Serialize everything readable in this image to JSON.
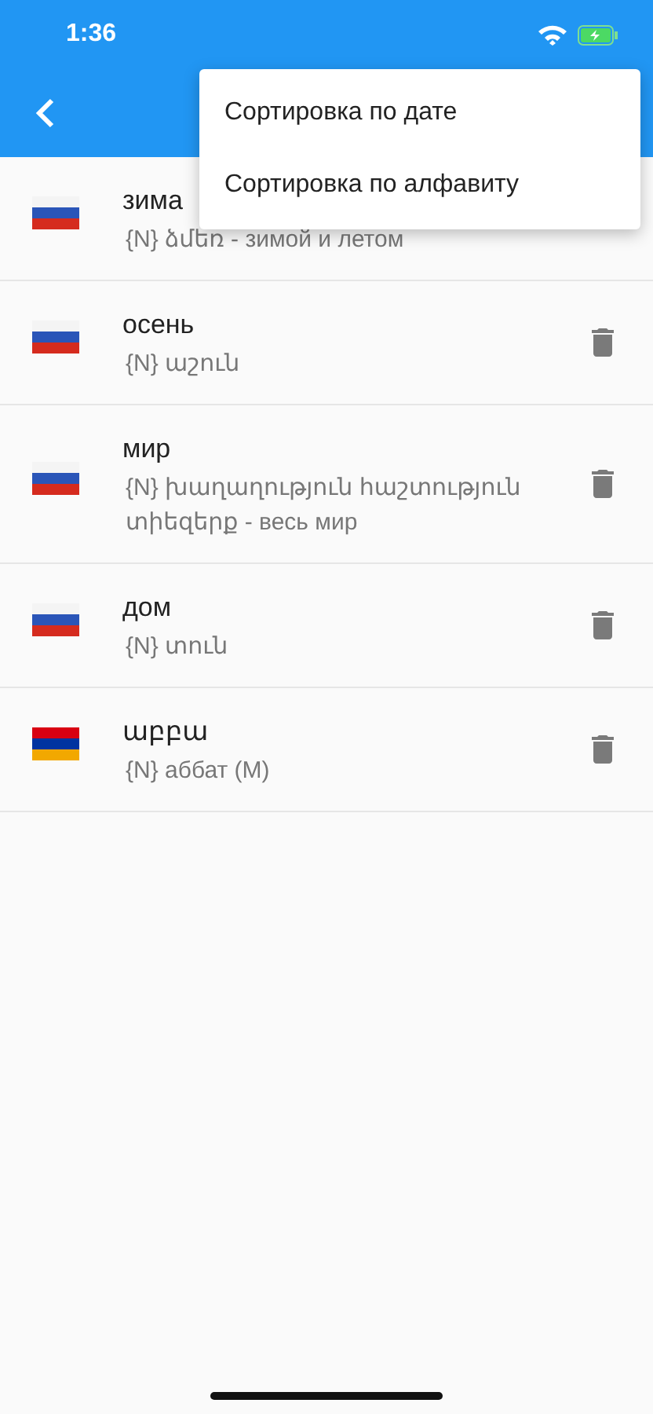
{
  "status_bar": {
    "time": "1:36"
  },
  "menu": {
    "items": [
      {
        "label": "Сортировка по дате"
      },
      {
        "label": "Сортировка по алфавиту"
      }
    ]
  },
  "words": [
    {
      "kind": "ru",
      "word": "зима",
      "translation": "{N} ձմեռ - зимой и летом",
      "delete_icon": false
    },
    {
      "kind": "ru",
      "word": "осень",
      "translation": "{N} աշուն",
      "delete_icon": true
    },
    {
      "kind": "ru",
      "word": "мир",
      "translation": "{N} խաղաղություն հաշտություն տիեզերք - весь мир",
      "delete_icon": true
    },
    {
      "kind": "ru",
      "word": "дом",
      "translation": "{N} տուն",
      "delete_icon": true
    },
    {
      "kind": "am",
      "word": "աբբա",
      "translation": "{N} аббат (M)",
      "delete_icon": true
    }
  ]
}
